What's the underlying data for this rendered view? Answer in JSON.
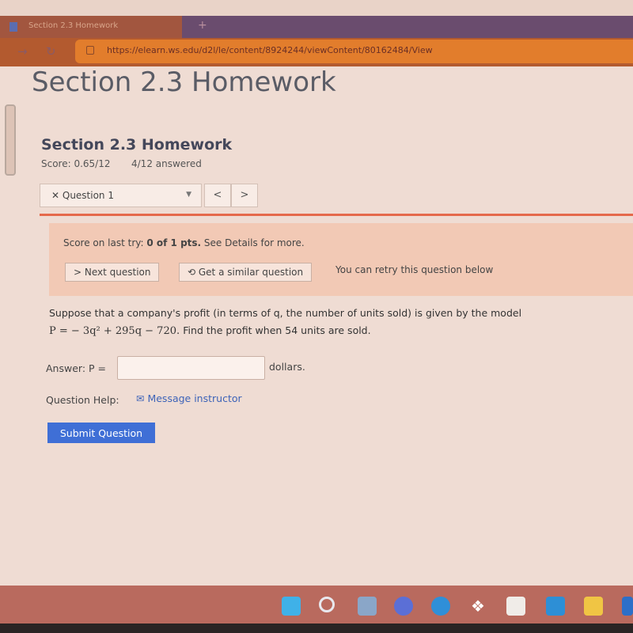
{
  "browser": {
    "tab_title": "Section 2.3 Homework",
    "url": "https://elearn.ws.edu/d2l/le/content/8924244/viewContent/80162484/View"
  },
  "page": {
    "title": "Section 2.3 Homework"
  },
  "assignment": {
    "title": "Section 2.3 Homework",
    "score": "Score: 0.65/12",
    "answered": "4/12 answered"
  },
  "question_nav": {
    "selected": "✕ Question 1",
    "prev": "<",
    "next": ">"
  },
  "alert": {
    "prefix": "Score on last try: ",
    "score": "0 of 1 pts.",
    "suffix": " See Details for more.",
    "next_question": "> Next question",
    "similar": "Get a similar question",
    "retry_note": "You can retry this question below"
  },
  "question": {
    "line1": "Suppose that a company's profit (in terms of q, the number of units sold) is given by the model",
    "formula": "P = − 3q² + 295q − 720.",
    "line2": "Find the profit when 54 units are sold."
  },
  "answer": {
    "label": "Answer: P =",
    "value": "",
    "unit": "dollars."
  },
  "help": {
    "label": "Question Help:",
    "message": "Message instructor"
  },
  "submit_label": "Submit Question",
  "taskbar": {
    "icons": [
      "windows-start",
      "search",
      "task-view",
      "teams-meet",
      "edge",
      "dropbox",
      "store",
      "mail",
      "file-explorer",
      "calendar"
    ]
  }
}
